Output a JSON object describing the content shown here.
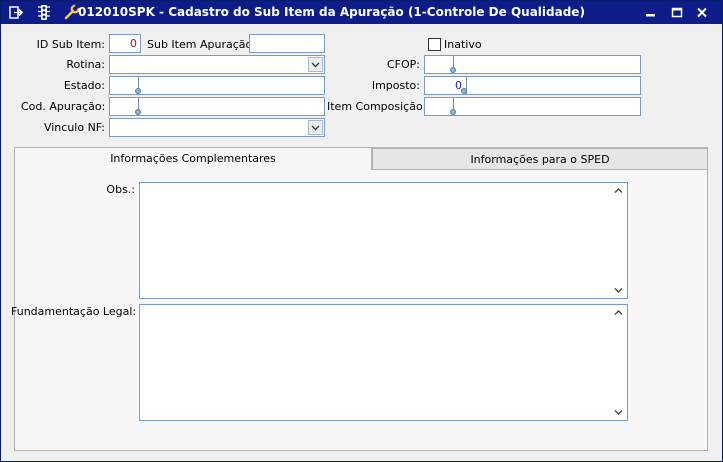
{
  "window": {
    "title": "012010SPK - Cadastro do Sub Item da Apuração (1-Controle De Qualidade)"
  },
  "form": {
    "id_sub_item_label": "ID Sub Item:",
    "id_sub_item_value": "0",
    "sub_item_apuracao_label": "Sub Item Apuração:",
    "sub_item_apuracao_value": "",
    "inativo_label": "Inativo",
    "inativo_checked": false,
    "rotina_label": "Rotina:",
    "rotina_value": "",
    "cfop_label": "CFOP:",
    "cfop_value": "",
    "estado_label": "Estado:",
    "estado_value": "",
    "imposto_label": "Imposto:",
    "imposto_value": "0",
    "cod_apuracao_label": "Cod. Apuração:",
    "cod_apuracao_value": "",
    "item_composicao_label": "Item Composição:",
    "item_composicao_value": "",
    "vinculo_nf_label": "Vinculo NF:",
    "vinculo_nf_value": ""
  },
  "tabs": [
    {
      "label": "Informações Complementares",
      "active": true
    },
    {
      "label": "Informações para o SPED",
      "active": false
    }
  ],
  "panel": {
    "obs_label": "Obs.:",
    "obs_value": "",
    "fundamentacao_label": "Fundamentação Legal:",
    "fundamentacao_value": ""
  },
  "icons": {
    "toolbar": [
      "exit-icon",
      "traffic-light-icon",
      "wrench-icon"
    ],
    "window": [
      "minimize-icon",
      "maximize-icon",
      "close-icon"
    ]
  }
}
